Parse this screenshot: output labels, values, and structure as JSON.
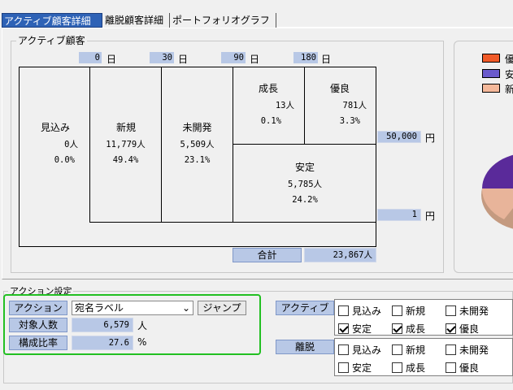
{
  "tabs": [
    {
      "label": "アクティブ顧客詳細",
      "active": true
    },
    {
      "label": "離脱顧客詳細",
      "active": false
    },
    {
      "label": "ポートフォリオグラフ",
      "active": false
    }
  ],
  "active_group": {
    "title": "アクティブ顧客",
    "days": [
      {
        "value": "0",
        "unit": "日"
      },
      {
        "value": "30",
        "unit": "日"
      },
      {
        "value": "90",
        "unit": "日"
      },
      {
        "value": "180",
        "unit": "日"
      }
    ],
    "segments": {
      "mikomi": {
        "name": "見込み",
        "count": "0人",
        "ratio": "0.0%"
      },
      "shinki": {
        "name": "新規",
        "count": "11,779人",
        "ratio": "49.4%"
      },
      "mikaihatsu": {
        "name": "未開発",
        "count": "5,509人",
        "ratio": "23.1%"
      },
      "seichou": {
        "name": "成長",
        "count": "13人",
        "ratio": "0.1%"
      },
      "yuuryou": {
        "name": "優良",
        "count": "781人",
        "ratio": "3.3%"
      },
      "antei": {
        "name": "安定",
        "count": "5,785人",
        "ratio": "24.2%"
      }
    },
    "amount_high": {
      "value": "50,000",
      "unit": "円"
    },
    "amount_low": {
      "value": "1",
      "unit": "円"
    },
    "total": {
      "label": "合計",
      "value": "23,867人"
    }
  },
  "legend": {
    "colors": [
      "#f05a28",
      "#6a5acd",
      "#f4b89a"
    ],
    "labels": [
      "優",
      "安",
      "新"
    ]
  },
  "pie": {
    "colors": {
      "slice_purple": "#5a2a9a",
      "slice_peach": "#e8b49a"
    }
  },
  "action_group": {
    "title": "アクション設定",
    "action_label": "アクション",
    "action_select": "宛名ラベル",
    "jump_label": "ジャンプ",
    "count_label": "対象人数",
    "count_value": "6,579",
    "count_unit": "人",
    "ratio_label": "構成比率",
    "ratio_value": "27.6",
    "ratio_unit": "%"
  },
  "filters": {
    "active_label": "アクティブ",
    "churn_label": "離脱",
    "active_checks": [
      {
        "label": "見込み",
        "checked": false
      },
      {
        "label": "新規",
        "checked": false
      },
      {
        "label": "未開発",
        "checked": false
      },
      {
        "label": "安定",
        "checked": true
      },
      {
        "label": "成長",
        "checked": true
      },
      {
        "label": "優良",
        "checked": true
      }
    ],
    "churn_checks": [
      {
        "label": "見込み",
        "checked": false
      },
      {
        "label": "新規",
        "checked": false
      },
      {
        "label": "未開発",
        "checked": false
      },
      {
        "label": "安定",
        "checked": false
      },
      {
        "label": "成長",
        "checked": false
      },
      {
        "label": "優良",
        "checked": false
      }
    ]
  }
}
